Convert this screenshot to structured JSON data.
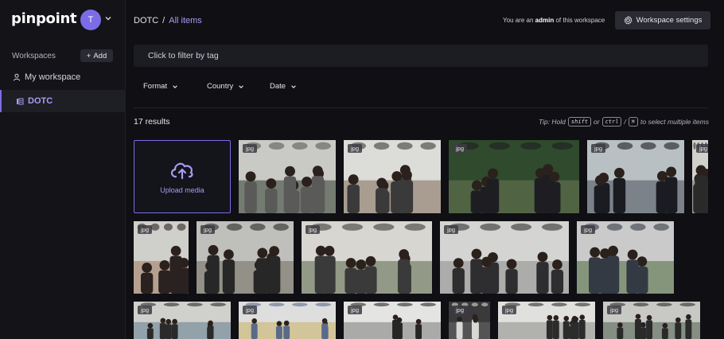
{
  "app": {
    "logo": "pinpoint",
    "avatar_initial": "T"
  },
  "sidebar": {
    "workspaces_label": "Workspaces",
    "add_label": "Add",
    "items": [
      {
        "label": "My workspace",
        "icon": "user-icon"
      },
      {
        "label": "DOTC",
        "icon": "library-icon",
        "active": true
      }
    ]
  },
  "header": {
    "breadcrumb": [
      "DOTC",
      "/",
      "All items"
    ],
    "role_prefix": "You are an",
    "role": "admin",
    "role_suffix": "of this workspace",
    "settings_label": "Workspace settings"
  },
  "filter": {
    "placeholder": "Click to filter by tag"
  },
  "facets": [
    "Format",
    "Country",
    "Date"
  ],
  "results": {
    "count_text": "17 results",
    "tip_prefix": "Tip: Hold",
    "key_shift": "shift",
    "or": "or",
    "key_ctrl": "ctrl",
    "slash": "/",
    "key_cmd": "⌘",
    "tip_suffix": "to select multiple items"
  },
  "upload": {
    "label": "Upload media"
  },
  "media": [
    {
      "format": "jpg",
      "palette": [
        "#c9c9c6",
        "#5a5a58",
        "#2d3b2a"
      ]
    },
    {
      "format": "jpg",
      "palette": [
        "#dcdcd8",
        "#3a3a3a",
        "#7d6a56"
      ]
    },
    {
      "format": "jpg",
      "palette": [
        "#2f4a2c",
        "#1e1e22",
        "#6c7a5a"
      ]
    },
    {
      "format": "jpg",
      "palette": [
        "#b8c0c4",
        "#1a1c22",
        "#4a4e5a"
      ]
    },
    {
      "format": "jpg",
      "palette": [
        "#d0d0cc",
        "#2a2a2a",
        "#6c6c6c"
      ]
    },
    {
      "format": "jpg",
      "palette": [
        "#cfcfcb",
        "#2a2220",
        "#a07a5e"
      ]
    },
    {
      "format": "jpg",
      "palette": [
        "#bfbfbb",
        "#272727",
        "#6e6a5c"
      ]
    },
    {
      "format": "jpg",
      "palette": [
        "#d8d6d0",
        "#3a3a3a",
        "#5a6a4a"
      ]
    },
    {
      "format": "jpg",
      "palette": [
        "#d4d4d2",
        "#2e2e30",
        "#8a8a88"
      ]
    },
    {
      "format": "jpg",
      "palette": [
        "#cacaca",
        "#343a44",
        "#4a6a3a"
      ]
    },
    {
      "format": "jpg",
      "palette": [
        "#d0d0cc",
        "#2a2a2a",
        "#5e7a8e"
      ]
    },
    {
      "format": "jpg",
      "palette": [
        "#dedede",
        "#5a6a8a",
        "#c8b060"
      ]
    },
    {
      "format": "jpg",
      "palette": [
        "#e4e4e2",
        "#262626",
        "#7a7a7a"
      ]
    },
    {
      "format": "jpg",
      "palette": [
        "#3a3a3c",
        "#d8d8d4",
        "#6a6a6a"
      ]
    },
    {
      "format": "jpg",
      "palette": [
        "#e0e0de",
        "#2c2c2c",
        "#8a8a86"
      ]
    },
    {
      "format": "jpg",
      "palette": [
        "#c8c8c4",
        "#2a2a2a",
        "#4e5e4e"
      ]
    }
  ]
}
